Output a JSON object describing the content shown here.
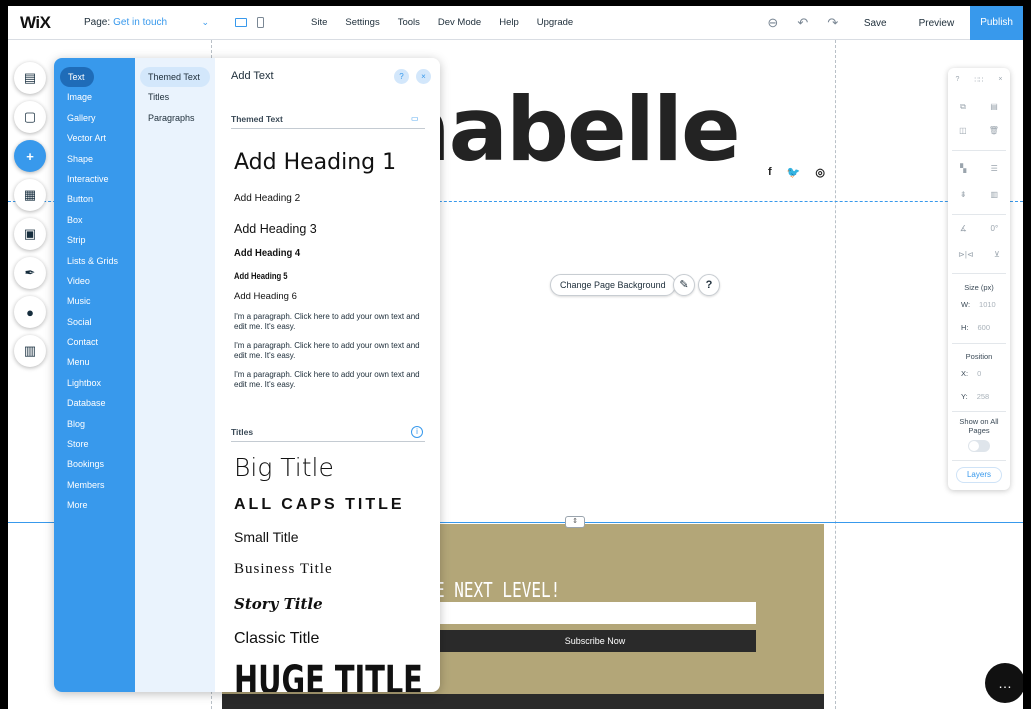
{
  "topbar": {
    "logo": "WiX",
    "page_label": "Page:",
    "page_name": "Get in touch",
    "menu": [
      "Site",
      "Settings",
      "Tools",
      "Dev Mode",
      "Help",
      "Upgrade"
    ],
    "save": "Save",
    "preview": "Preview",
    "publish": "Publish",
    "icons": [
      "zoom-icon",
      "undo-icon",
      "redo-icon"
    ]
  },
  "canvas": {
    "site_title": "nabelle",
    "social_icons": [
      "f",
      "🐦",
      "◎"
    ],
    "change_bg": "Change Page Background",
    "edit_icon": "✎",
    "help_icon": "?",
    "subscribe_heading": "E NEXT LEVEL!",
    "subscribe_button": "Subscribe Now"
  },
  "left_rail": {
    "icons": [
      "pages-icon",
      "background-icon",
      "add-icon",
      "add-apps-icon",
      "media-icon",
      "blog-icon",
      "chat-icon",
      "bookings-icon"
    ]
  },
  "add_panel": {
    "title": "Add Text",
    "help": "?",
    "close": "×",
    "categories": [
      "Text",
      "Image",
      "Gallery",
      "Vector Art",
      "Shape",
      "Interactive",
      "Button",
      "Box",
      "Strip",
      "Lists & Grids",
      "Video",
      "Music",
      "Social",
      "Contact",
      "Menu",
      "Lightbox",
      "Database",
      "Blog",
      "Store",
      "Bookings",
      "Members",
      "More"
    ],
    "subcategories": [
      "Themed Text",
      "Titles",
      "Paragraphs"
    ],
    "themed_text_section": "Themed Text",
    "headings": [
      "Add Heading 1",
      "Add Heading 2",
      "Add Heading 3",
      "Add Heading 4",
      "Add Heading 5",
      "Add Heading 6"
    ],
    "paragraphs": [
      "I'm a paragraph. Click here to add your own text and edit me. It's easy.",
      "I'm a paragraph. Click here to add your own text and edit me. It's easy.",
      "I'm a paragraph. Click here to add your own text and edit me. It's easy."
    ],
    "titles_section": "Titles",
    "titles": [
      "Big Title",
      "ALL CAPS TITLE",
      "Small Title",
      "Business Title",
      "Story Title",
      "Classic Title",
      "HUGE TITLE"
    ]
  },
  "inspector": {
    "help": "?",
    "move": "∷∷",
    "close": "×",
    "size_label": "Size (px)",
    "w_label": "W:",
    "w_value": "1010",
    "h_label": "H:",
    "h_value": "600",
    "position_label": "Position",
    "x_label": "X:",
    "x_value": "0",
    "y_label": "Y:",
    "y_value": "258",
    "rotate_value": "0°",
    "show_all_label": "Show on All Pages",
    "layers": "Layers"
  },
  "colors": {
    "accent": "#3899ec",
    "category_bg": "#3899ec",
    "subscribe_strip": "#b3a678"
  }
}
